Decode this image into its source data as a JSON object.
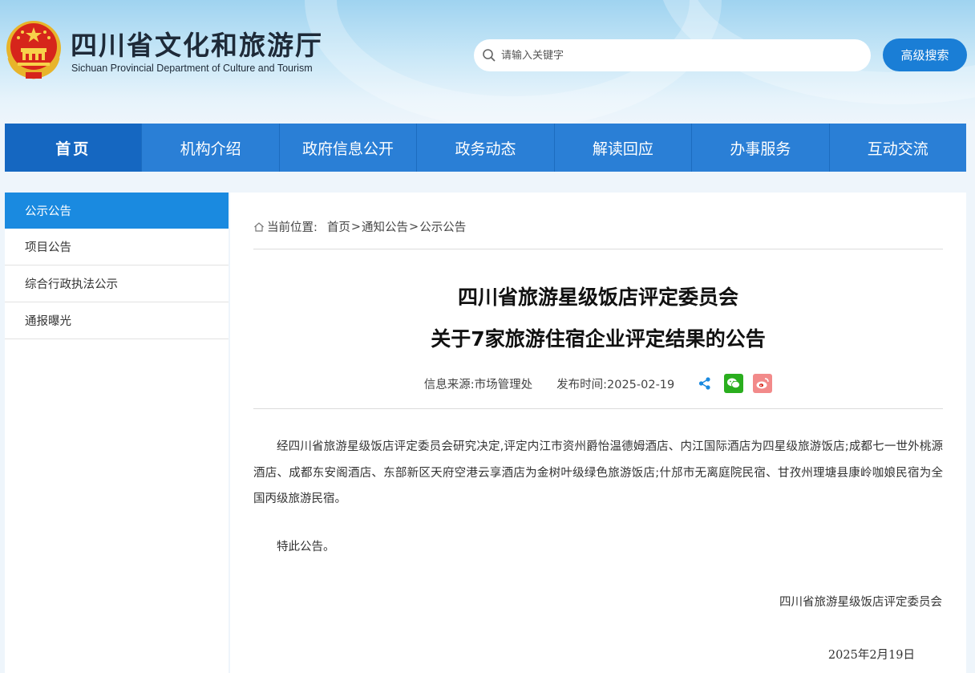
{
  "header": {
    "title": "四川省文化和旅游厅",
    "subtitle": "Sichuan Provincial Department of Culture and Tourism",
    "search_placeholder": "请输入关键字",
    "advanced_search_label": "高级搜索"
  },
  "nav": {
    "items": [
      "首页",
      "机构介绍",
      "政府信息公开",
      "政务动态",
      "解读回应",
      "办事服务",
      "互动交流"
    ],
    "active_index": 0
  },
  "sidebar": {
    "items": [
      "公示公告",
      "项目公告",
      "综合行政执法公示",
      "通报曝光"
    ],
    "active_index": 0
  },
  "breadcrumb": {
    "label": "当前位置:",
    "items": [
      "首页",
      "通知公告",
      "公示公告"
    ],
    "separator": ">"
  },
  "article": {
    "title_line1": "四川省旅游星级饭店评定委员会",
    "title_line2": "关于7家旅游住宿企业评定结果的公告",
    "source": "信息来源:市场管理处",
    "publish_time": "发布时间:2025-02-19",
    "body": "经四川省旅游星级饭店评定委员会研究决定,评定内江市资州爵怡温德姆酒店、内江国际酒店为四星级旅游饭店;成都七一世外桃源酒店、成都东安阁酒店、东部新区天府空港云享酒店为金树叶级绿色旅游饭店;什邡市无离庭院民宿、甘孜州理塘县康岭咖娘民宿为全国丙级旅游民宿。",
    "closing": "特此公告。",
    "signer": "四川省旅游星级饭店评定委员会",
    "date": "2025年2月19日"
  },
  "colors": {
    "nav_bg": "#2a7fd6",
    "nav_active": "#1567c1",
    "sidebar_active": "#1a8ae0",
    "button": "#1a7ed6"
  },
  "icons": {
    "share": "share-icon",
    "wechat": "wechat-icon",
    "weibo": "weibo-icon"
  }
}
